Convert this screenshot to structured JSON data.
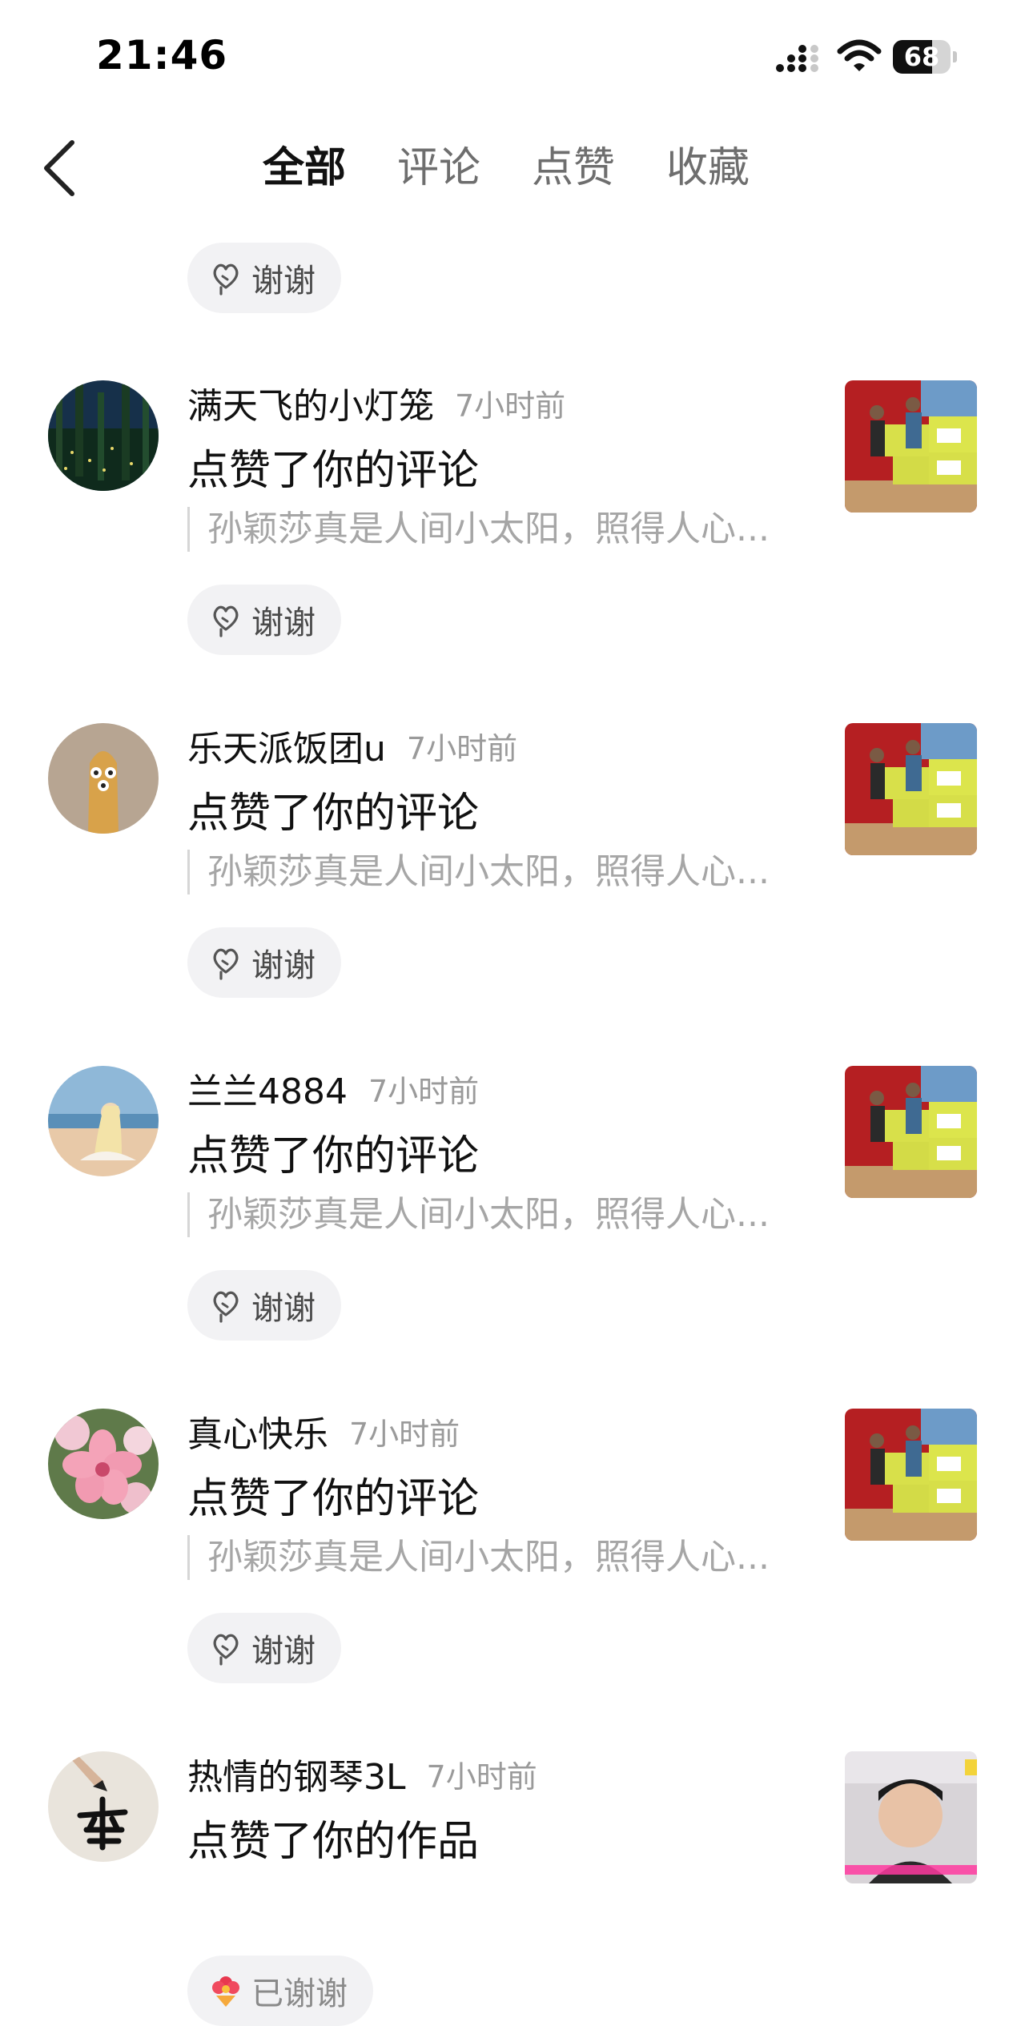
{
  "status_bar": {
    "time": "21:46",
    "battery": "68",
    "battery_level": 0.68
  },
  "header": {
    "tabs": [
      {
        "label": "全部",
        "active": true
      },
      {
        "label": "评论",
        "active": false
      },
      {
        "label": "点赞",
        "active": false
      },
      {
        "label": "收藏",
        "active": false
      }
    ]
  },
  "top_thanks": {
    "label": "谢谢"
  },
  "notifications": [
    {
      "username": "满天飞的小灯笼",
      "time": "7小时前",
      "action": "点赞了你的评论",
      "quote": "孙颖莎真是人间小太阳，照得人心...",
      "button": "谢谢"
    },
    {
      "username": "乐天派饭团u",
      "time": "7小时前",
      "action": "点赞了你的评论",
      "quote": "孙颖莎真是人间小太阳，照得人心...",
      "button": "谢谢"
    },
    {
      "username": "兰兰4884",
      "time": "7小时前",
      "action": "点赞了你的评论",
      "quote": "孙颖莎真是人间小太阳，照得人心...",
      "button": "谢谢"
    },
    {
      "username": "真心快乐",
      "time": "7小时前",
      "action": "点赞了你的评论",
      "quote": "孙颖莎真是人间小太阳，照得人心...",
      "button": "谢谢"
    },
    {
      "username": "热情的钢琴3L",
      "time": "7小时前",
      "action": "点赞了你的作品",
      "button": "已谢谢"
    }
  ],
  "colors": {
    "pill_bg": "#f2f2f4",
    "muted": "#9a9a9a"
  }
}
